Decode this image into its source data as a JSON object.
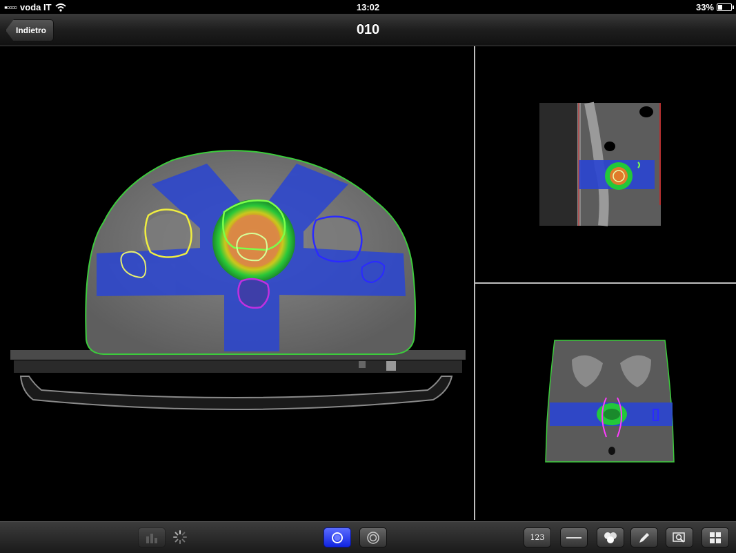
{
  "status": {
    "carrier": "voda IT",
    "time": "13:02",
    "battery": "33%",
    "battery_level": 0.33
  },
  "nav": {
    "back_label": "Indietro",
    "title": "010"
  },
  "views": {
    "axial": "axial-ct-view",
    "sagittal": "sagittal-ct-view",
    "coronal": "coronal-ct-view"
  },
  "toolbar": {
    "numbers_label": "123",
    "icons": [
      "histogram-icon",
      "loading-spinner-icon",
      "single-ring-icon",
      "double-ring-icon",
      "numbers-icon",
      "ruler-icon",
      "structures-icon",
      "pencil-icon",
      "zoom-icon",
      "layout-grid-icon"
    ]
  },
  "colors": {
    "dose_low": "#2a4bd6",
    "dose_mid": "#22c83a",
    "dose_high": "#f07a1a",
    "body_contour": "#2ecc40"
  }
}
